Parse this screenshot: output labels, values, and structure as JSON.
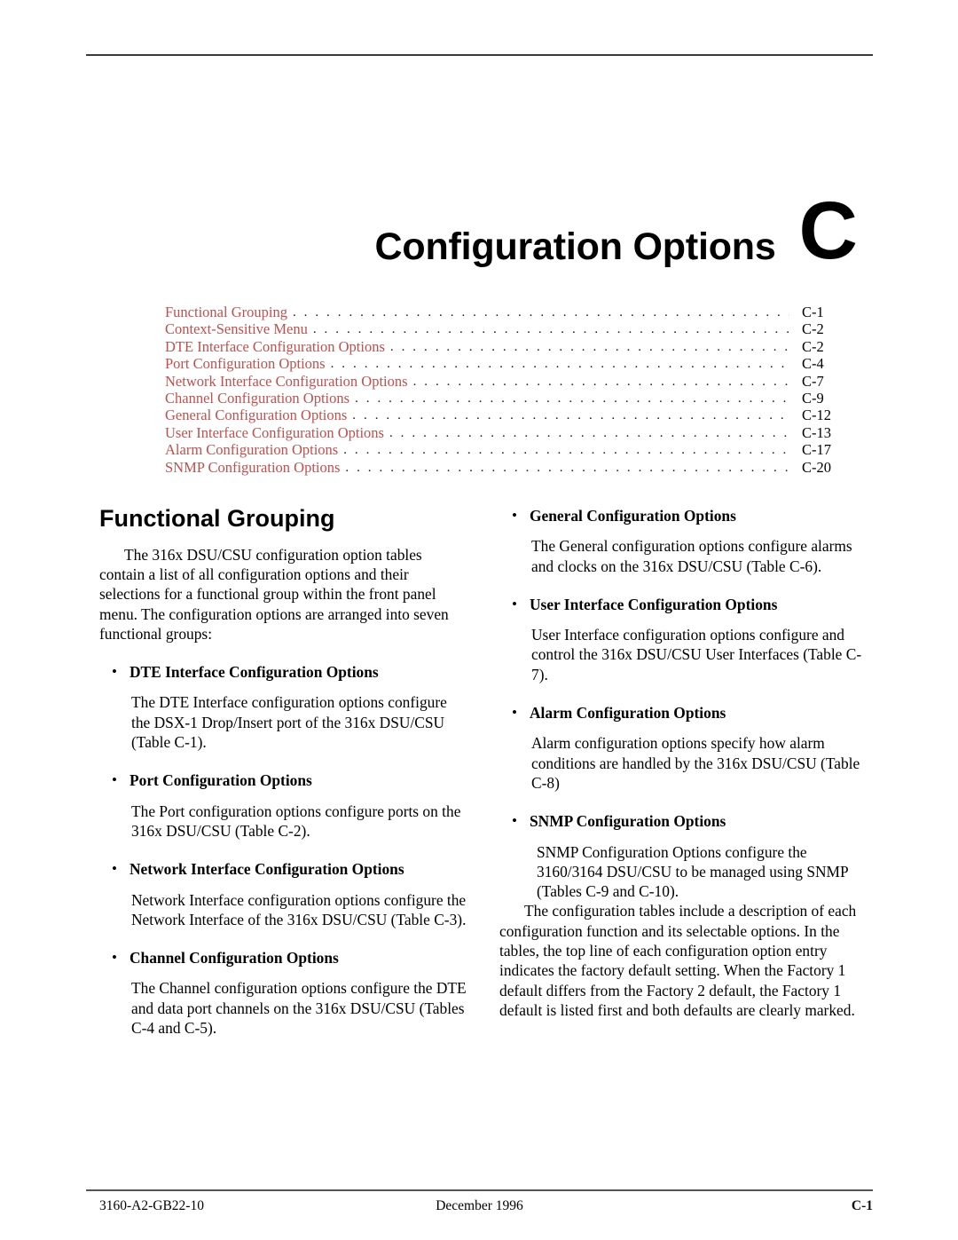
{
  "document": {
    "chapter_title": "Configuration Options",
    "chapter_letter": "C"
  },
  "toc": {
    "entries": [
      {
        "label": "Functional Grouping",
        "page": "C-1"
      },
      {
        "label": "Context-Sensitive Menu",
        "page": "C-2"
      },
      {
        "label": "DTE Interface Configuration Options",
        "page": "C-2"
      },
      {
        "label": "Port Configuration Options",
        "page": "C-4"
      },
      {
        "label": "Network Interface Configuration Options",
        "page": "C-7"
      },
      {
        "label": "Channel Configuration Options",
        "page": "C-9"
      },
      {
        "label": "General Configuration Options",
        "page": "C-12"
      },
      {
        "label": "User Interface Configuration Options",
        "page": "C-13"
      },
      {
        "label": "Alarm Configuration Options",
        "page": "C-17"
      },
      {
        "label": "SNMP Configuration Options",
        "page": "C-20"
      }
    ],
    "leader": ". . . . . . . . . . . . . . . . . . . . . . . . . . . . . . . . . . . . . . . . . . . . . . . . . . . . . . . . . . . . . . . . . . . . . . . . . . . . . . . . . . . . . . . . . . . . . . . . . . . ."
  },
  "left_column": {
    "heading": "Functional Grouping",
    "intro": "The 316x DSU/CSU configuration option tables contain a list of all configuration options and their selections for a functional group within the front panel menu. The configuration options are arranged into seven functional groups:",
    "bullets": [
      {
        "title": "DTE Interface Configuration Options",
        "body": "The DTE Interface configuration options configure the DSX-1 Drop/Insert port of the 316x DSU/CSU (Table C-1)."
      },
      {
        "title": "Port Configuration Options",
        "body": "The Port configuration options configure ports on the 316x DSU/CSU (Table C-2)."
      },
      {
        "title": "Network Interface Configuration Options",
        "body": "Network Interface configuration options configure the Network Interface of the 316x DSU/CSU (Table C-3)."
      },
      {
        "title": "Channel Configuration Options",
        "body": "The Channel configuration options configure the DTE and data port channels on the 316x DSU/CSU (Tables C-4 and C-5)."
      }
    ]
  },
  "right_column": {
    "bullets": [
      {
        "title": "General Configuration Options",
        "body": "The General configuration options configure alarms and clocks on the 316x DSU/CSU (Table C-6)."
      },
      {
        "title": "User Interface Configuration Options",
        "body": "User Interface configuration options configure and control the 316x DSU/CSU User Interfaces (Table C-7)."
      },
      {
        "title": "Alarm Configuration Options",
        "body": "Alarm configuration options specify how alarm conditions are handled by the 316x DSU/CSU (Table C-8)"
      },
      {
        "title": "SNMP Configuration Options",
        "body": "SNMP Configuration Options configure the 3160/3164 DSU/CSU to be managed using SNMP (Tables C-9 and C-10)."
      }
    ],
    "closing": "The configuration tables include a description of each configuration function and its selectable options. In the tables, the top line of each configuration option entry indicates the factory default setting. When the Factory 1 default differs from the Factory 2 default, the Factory 1 default is listed first and both defaults are clearly marked."
  },
  "footer": {
    "doc_number": "3160-A2-GB22-10",
    "date": "December 1996",
    "page_number": "C-1"
  },
  "colors": {
    "toc_link": "#c0504d",
    "text": "#000000",
    "rule": "#3a3a3a"
  },
  "bullet_glyph": "•"
}
